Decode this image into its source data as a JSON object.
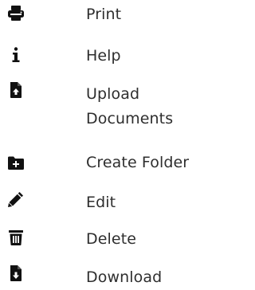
{
  "menu": {
    "items": [
      {
        "label": "Print",
        "icon": "print-icon"
      },
      {
        "label": "Help",
        "icon": "info-icon"
      },
      {
        "label": "Upload Documents",
        "icon": "file-upload-icon"
      },
      {
        "label": "Create Folder",
        "icon": "folder-plus-icon"
      },
      {
        "label": "Edit",
        "icon": "pencil-icon"
      },
      {
        "label": "Delete",
        "icon": "trash-icon"
      },
      {
        "label": "Download",
        "icon": "file-download-icon"
      }
    ]
  },
  "colors": {
    "icon": "#111111",
    "text": "#2e2e2e",
    "background": "#ffffff"
  }
}
